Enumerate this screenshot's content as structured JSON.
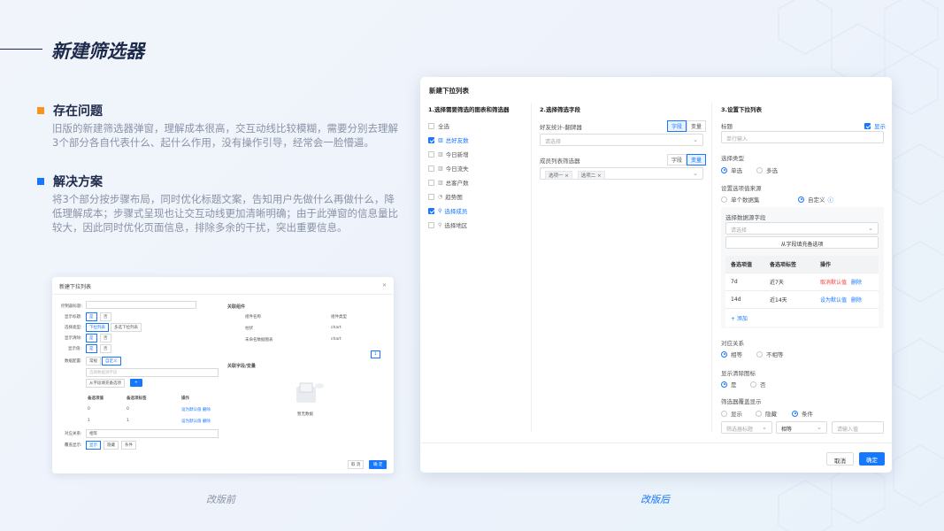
{
  "page": {
    "title": "新建筛选器",
    "problem": {
      "heading": "存在问题",
      "text": "旧版的新建筛选器弹窗，理解成本很高，交互动线比较模糊，需要分别去理解3个部分各自代表什么、起什么作用，没有操作引导，经常会一脸懵逼。"
    },
    "solution": {
      "heading": "解决方案",
      "text": "将3个部分按步骤布局，同时优化标题文案，告知用户先做什么再做什么，降低理解成本；步骤式呈现也让交互动线更加清晰明确；由于此弹窗的信息量比较大，因此同时优化页面信息，排除多余的干扰，突出重要信息。"
    },
    "caption_before": "改版前",
    "caption_after": "改版后",
    "colors": {
      "accent_orange": "#f7931e",
      "accent_blue": "#1677ff",
      "title": "#1e2a4a"
    }
  },
  "old_dialog": {
    "title": "新建下拉列表",
    "close_icon": "close-icon",
    "labels": {
      "control_title": "控制器标题:",
      "show_title": "显示标题:",
      "select_type": "选择类型:",
      "show_clear": "显示清除:",
      "show_value": "显示值:",
      "data_config": "数据配置:",
      "relation": "对应关系:",
      "page_show": "覆盖显示:"
    },
    "yes": "是",
    "no": "否",
    "type_dropdown": "下拉列表",
    "type_multi": "多选下拉列表",
    "config_normal": "常规",
    "config_custom": "自定义",
    "select_source_placeholder": "选择数据源字段",
    "fill_from_field": "从字段填充备选项",
    "add_icon": "+",
    "table_headers": [
      "备选项值",
      "备选项标签",
      "操作"
    ],
    "table_rows": [
      {
        "value": "0",
        "label": "0",
        "actions": "设为默认值  删除"
      },
      {
        "value": "1",
        "label": "1",
        "actions": "设为默认值  删除"
      }
    ],
    "relation_value": "相等",
    "page_show_options": [
      "显示",
      "隐藏",
      "条件"
    ],
    "assoc_component_title": "关联组件",
    "assoc_headers": [
      "组件名称",
      "组件类型"
    ],
    "assoc_rows": [
      {
        "name": "柱状",
        "type": "chart"
      },
      {
        "name": "未命名数据图表",
        "type": "chart"
      }
    ],
    "pager_current": "1",
    "assoc_field_title": "关联字段/变量",
    "empty_text": "暂无数据",
    "cancel": "取 消",
    "ok": "确 定"
  },
  "new_dialog": {
    "title": "新建下拉列表",
    "step1": {
      "title": "1.选择需要筛选的图表和筛选器",
      "items": [
        {
          "label": "全选",
          "checked": false,
          "icon": ""
        },
        {
          "label": "总好友数",
          "checked": true,
          "icon": "bar-chart-icon"
        },
        {
          "label": "今日新增",
          "checked": false,
          "icon": "bar-chart-icon"
        },
        {
          "label": "今日流失",
          "checked": false,
          "icon": "bar-chart-icon"
        },
        {
          "label": "总客户数",
          "checked": false,
          "icon": "bar-chart-icon"
        },
        {
          "label": "趋势图",
          "checked": false,
          "icon": "line-chart-icon"
        },
        {
          "label": "选择成员",
          "checked": true,
          "icon": "filter-icon"
        },
        {
          "label": "选择地区",
          "checked": false,
          "icon": "filter-icon"
        }
      ]
    },
    "step2": {
      "title": "2.选择筛选字段",
      "group1": {
        "label": "好友统计-翻牌器",
        "seg": [
          "字段",
          "变量"
        ],
        "seg_on": 0,
        "placeholder": "请选择"
      },
      "group2": {
        "label": "成员列表筛选器",
        "seg": [
          "字段",
          "变量"
        ],
        "seg_on": 1,
        "tags": [
          "选项一 ×",
          "选项二 ×"
        ]
      }
    },
    "step3": {
      "title": "3.设置下拉列表",
      "title_label": "标题",
      "show_label": "显示",
      "title_placeholder": "单行输入",
      "select_type_label": "选择类型",
      "single": "单选",
      "multi": "多选",
      "source_label": "设置选项值来源",
      "source_single": "单个数据集",
      "source_custom": "自定义",
      "info_icon": "info-icon",
      "panel_field_label": "选择数据源字段",
      "panel_placeholder": "请选择",
      "fill_button": "从字段填充备选项",
      "table_headers": [
        "备选项值",
        "备选项标签",
        "操作"
      ],
      "table_rows": [
        {
          "value": "7d",
          "label": "近7天",
          "action": "取消默认值",
          "action_red": true,
          "delete": "删除"
        },
        {
          "value": "14d",
          "label": "近14天",
          "action": "设为默认值",
          "action_red": false,
          "delete": "删除"
        }
      ],
      "add_label": "+ 添加",
      "relation_label": "对应关系",
      "relation_eq": "相等",
      "relation_neq": "不相等",
      "clear_icon_label": "显示清除图标",
      "yes": "是",
      "no": "否",
      "cover_label": "筛选器覆盖显示",
      "cover_show": "显示",
      "cover_hide": "隐藏",
      "cover_cond": "条件",
      "cond_title_placeholder": "筛选器标题",
      "cond_op": "相等",
      "cond_value_placeholder": "请输入值"
    },
    "cancel": "取消",
    "ok": "确定"
  }
}
